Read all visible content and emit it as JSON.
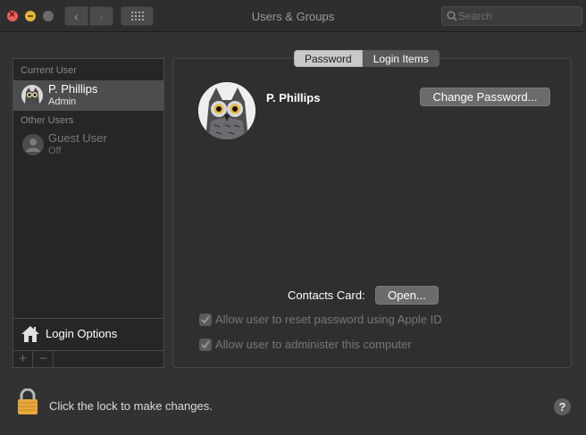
{
  "window": {
    "title": "Users & Groups"
  },
  "toolbar": {
    "back_icon": "chevron-left-icon",
    "forward_icon": "chevron-right-icon",
    "grid_icon": "grid-icon",
    "search_placeholder": "Search"
  },
  "sidebar": {
    "current_user_header": "Current User",
    "current_user": {
      "name": "P. Phillips",
      "role": "Admin"
    },
    "other_users_header": "Other Users",
    "other_users": [
      {
        "name": "Guest User",
        "role": "Off"
      }
    ],
    "login_options_label": "Login Options",
    "add_label": "+",
    "remove_label": "−"
  },
  "main": {
    "tabs": [
      {
        "label": "Password",
        "active": true
      },
      {
        "label": "Login Items",
        "active": false
      }
    ],
    "user_name": "P. Phillips",
    "change_password_label": "Change Password...",
    "contacts_card_label": "Contacts Card:",
    "open_label": "Open...",
    "checkboxes": [
      {
        "label": "Allow user to reset password using Apple ID",
        "checked": true,
        "enabled": false
      },
      {
        "label": "Allow user to administer this computer",
        "checked": true,
        "enabled": false
      }
    ]
  },
  "footer": {
    "lock_text": "Click the lock to make changes.",
    "help_label": "?"
  },
  "colors": {
    "close": "#ec5f5a",
    "minimize": "#e2b53f",
    "lock": "#e8a93a",
    "selection": "#4d4d4d"
  }
}
